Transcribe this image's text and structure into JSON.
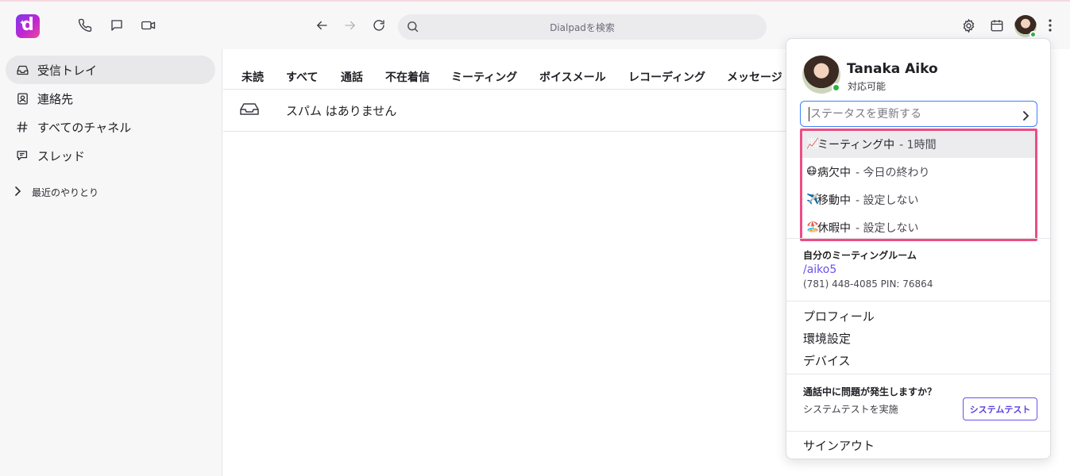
{
  "topbar": {
    "logo_letter": "d",
    "search_placeholder": "Dialpadを検索",
    "icons": [
      "phone-icon",
      "chat-icon",
      "video-icon",
      "back-arrow-icon",
      "forward-arrow-icon",
      "refresh-icon",
      "search-icon",
      "gear-icon",
      "calendar-icon",
      "more-vertical-icon"
    ]
  },
  "sidebar": {
    "items": [
      {
        "label": "受信トレイ",
        "icon": "inbox-icon",
        "active": true
      },
      {
        "label": "連絡先",
        "icon": "contacts-icon"
      },
      {
        "label": "すべてのチャネル",
        "icon": "hash-icon"
      },
      {
        "label": "スレッド",
        "icon": "threads-icon"
      }
    ],
    "recent_label": "最近のやりとり"
  },
  "tabs": [
    "未読",
    "すべて",
    "通話",
    "不在着信",
    "ミーティング",
    "ボイスメール",
    "レコーディング",
    "メッセージ"
  ],
  "inbox": {
    "spam_text": "スパム はありません"
  },
  "profile_menu": {
    "name": "Tanaka Aiko",
    "availability": "対応可能",
    "status_placeholder": "ステータスを更新する",
    "presets": [
      {
        "emoji": "📈",
        "label": "ミーティング中",
        "duration": "- 1時間"
      },
      {
        "emoji": "😷",
        "label": "病欠中",
        "duration": "- 今日の終わり"
      },
      {
        "emoji": "✈️",
        "label": "移動中",
        "duration": "- 設定しない"
      },
      {
        "emoji": "🏖️",
        "label": "休暇中",
        "duration": "- 設定しない"
      }
    ],
    "meeting_room_title": "自分のミーティングルーム",
    "meeting_room_link": "/aiko5",
    "meeting_room_number": "(781) 448-4085 PIN: 76864",
    "links": [
      "プロフィール",
      "環境設定",
      "デバイス"
    ],
    "problem_title": "通話中に問題が発生しますか？",
    "problem_sub": "システムテストを実施",
    "system_test_button": "システムテスト",
    "sign_out": "サインアウト"
  },
  "colors": {
    "accent": "#6b4ff0",
    "highlight_box": "#ec4d84",
    "online": "#2fb344",
    "focus": "#3b82f6"
  }
}
